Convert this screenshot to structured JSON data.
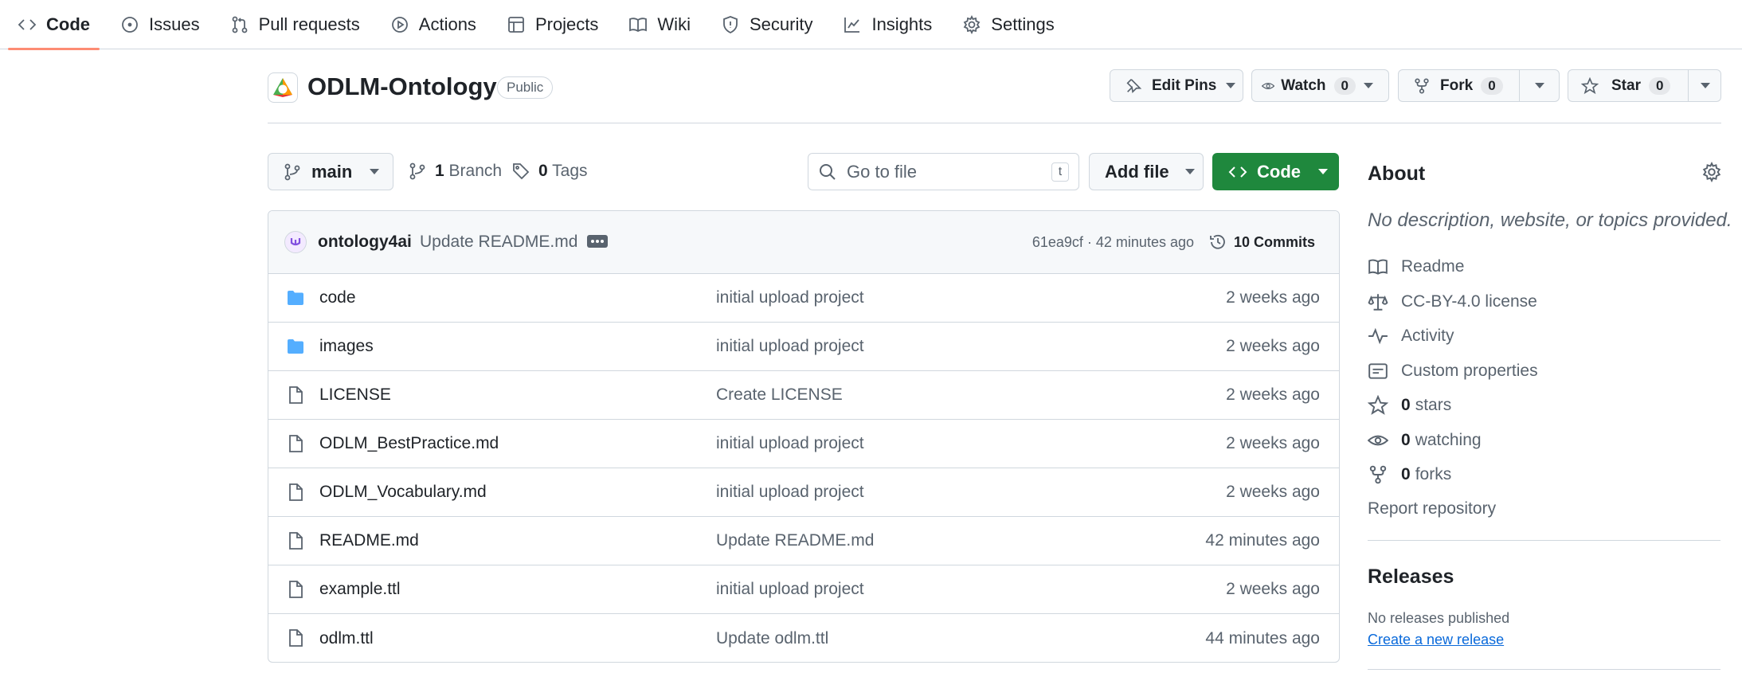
{
  "nav": {
    "tabs": [
      {
        "label": "Code",
        "icon": "code-icon",
        "active": true
      },
      {
        "label": "Issues",
        "icon": "issue-opened-icon"
      },
      {
        "label": "Pull requests",
        "icon": "git-pull-request-icon"
      },
      {
        "label": "Actions",
        "icon": "play-icon"
      },
      {
        "label": "Projects",
        "icon": "table-icon"
      },
      {
        "label": "Wiki",
        "icon": "book-icon"
      },
      {
        "label": "Security",
        "icon": "shield-icon"
      },
      {
        "label": "Insights",
        "icon": "graph-icon"
      },
      {
        "label": "Settings",
        "icon": "gear-icon"
      }
    ]
  },
  "repo": {
    "name": "ODLM-Ontology",
    "visibility": "Public",
    "edit_pins_label": "Edit Pins",
    "watch_label": "Watch",
    "watch_count": "0",
    "fork_label": "Fork",
    "fork_count": "0",
    "star_label": "Star",
    "star_count": "0"
  },
  "branch_bar": {
    "branch": "main",
    "branch_count": "1",
    "branch_label": "Branch",
    "tag_count": "0",
    "tag_label": "Tags",
    "search_placeholder": "Go to file",
    "search_shortcut": "t",
    "add_file_label": "Add file",
    "code_label": "Code"
  },
  "latest_commit": {
    "user": "ontology4ai",
    "message": "Update README.md",
    "meta": "61ea9cf · 42 minutes ago",
    "commits_count": "10",
    "commits_label": "Commits"
  },
  "files": [
    {
      "type": "folder",
      "name": "code",
      "message": "initial upload project",
      "time": "2 weeks ago"
    },
    {
      "type": "folder",
      "name": "images",
      "message": "initial upload project",
      "time": "2 weeks ago"
    },
    {
      "type": "file",
      "name": "LICENSE",
      "message": "Create LICENSE",
      "time": "2 weeks ago"
    },
    {
      "type": "file",
      "name": "ODLM_BestPractice.md",
      "message": "initial upload project",
      "time": "2 weeks ago"
    },
    {
      "type": "file",
      "name": "ODLM_Vocabulary.md",
      "message": "initial upload project",
      "time": "2 weeks ago"
    },
    {
      "type": "file",
      "name": "README.md",
      "message": "Update README.md",
      "time": "42 minutes ago"
    },
    {
      "type": "file",
      "name": "example.ttl",
      "message": "initial upload project",
      "time": "2 weeks ago"
    },
    {
      "type": "file",
      "name": "odlm.ttl",
      "message": "Update odlm.ttl",
      "time": "44 minutes ago"
    }
  ],
  "about": {
    "title": "About",
    "description": "No description, website, or topics provided.",
    "readme": "Readme",
    "license": "CC-BY-4.0 license",
    "activity": "Activity",
    "custom_properties": "Custom properties",
    "stars_count": "0",
    "stars_label": "stars",
    "watching_count": "0",
    "watching_label": "watching",
    "forks_count": "0",
    "forks_label": "forks",
    "report": "Report repository"
  },
  "releases": {
    "title": "Releases",
    "none": "No releases published",
    "create": "Create a new release"
  },
  "colors": {
    "accent_underline": "#fd8c73",
    "primary_green": "#1f883d",
    "folder_blue": "#54aeff",
    "link_blue": "#0969da"
  }
}
